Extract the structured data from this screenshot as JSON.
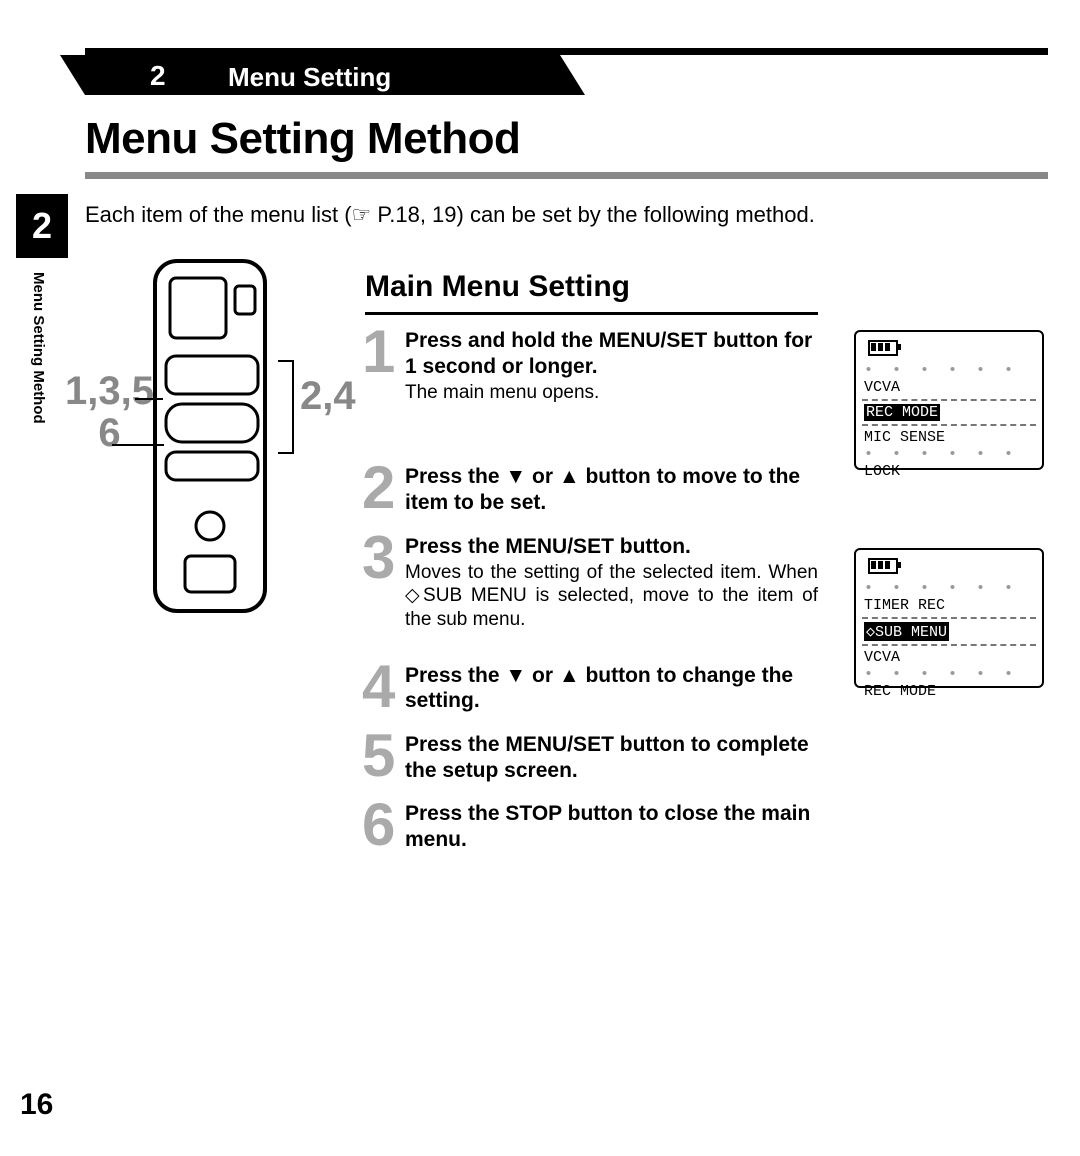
{
  "chapter": {
    "number": "2",
    "label": "Menu Setting"
  },
  "title": "Menu Setting Method",
  "intro": "Each item of the menu list (☞ P.18, 19) can be set by the following method.",
  "side_tab": "2",
  "side_caption": "Menu Setting Method",
  "callouts": {
    "left_top": "1,3,5",
    "left_bottom": "6",
    "right": "2,4"
  },
  "subsection": "Main Menu Setting",
  "steps": {
    "s1": {
      "num": "1",
      "head_pre": "Press and hold the ",
      "key": "MENU/SET",
      "head_post": " button for 1 second or longer.",
      "desc": "The main menu opens."
    },
    "s2": {
      "num": "2",
      "head_pre": "Press the ▼ or ▲ button to move to the item to be set."
    },
    "s3": {
      "num": "3",
      "head_pre": "Press the ",
      "key": "MENU/SET",
      "head_post": " button.",
      "desc": "Moves to the setting of the selected item. When ◇SUB MENU is selected, move to the item of the sub menu."
    },
    "s4": {
      "num": "4",
      "head_pre": "Press the ▼ or ▲ button to change the setting."
    },
    "s5": {
      "num": "5",
      "head_pre": "Press the ",
      "key": "MENU/SET",
      "head_post": " button to complete the setup screen."
    },
    "s6": {
      "num": "6",
      "head_pre": "Press the ",
      "key": "STOP",
      "head_post": " button to close the main menu."
    }
  },
  "lcd1": {
    "l1": "VCVA",
    "l2": "REC MODE",
    "l3": "MIC SENSE",
    "l4": "LOCK"
  },
  "lcd2": {
    "l1": "TIMER REC",
    "l2": "◇SUB MENU",
    "l3": "VCVA",
    "l4": "REC MODE"
  },
  "page_number": "16"
}
